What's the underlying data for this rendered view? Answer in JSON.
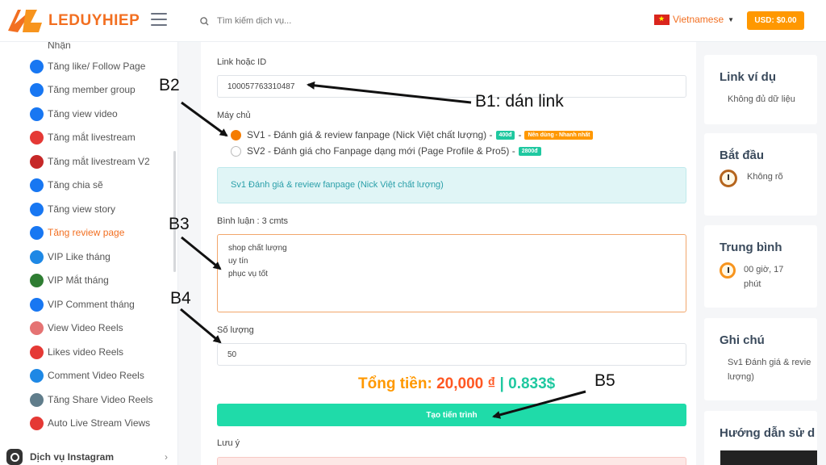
{
  "header": {
    "logo_text": "LEDUYHIEP",
    "search_placeholder": "Tìm kiếm dịch vụ...",
    "language": "Vietnamese",
    "balance_button": "USD: $0.00"
  },
  "sidebar": {
    "items": [
      {
        "label": "Nhận",
        "icon": "partial-icon",
        "color": "#9aa"
      },
      {
        "label": "Tăng like/ Follow Page",
        "icon": "flag-icon",
        "color": "#1877f2"
      },
      {
        "label": "Tăng member group",
        "icon": "group-icon",
        "color": "#1877f2"
      },
      {
        "label": "Tăng view video",
        "icon": "play-icon",
        "color": "#1877f2"
      },
      {
        "label": "Tăng mắt livestream",
        "icon": "live-icon",
        "color": "#e53935"
      },
      {
        "label": "Tăng mắt livestream V2",
        "icon": "eye-icon",
        "color": "#c62828"
      },
      {
        "label": "Tăng chia sẽ",
        "icon": "share-icon",
        "color": "#1877f2"
      },
      {
        "label": "Tăng view story",
        "icon": "heart-icon",
        "color": "#1877f2"
      },
      {
        "label": "Tăng review page",
        "icon": "palette-icon",
        "color": "#1877f2",
        "active": true
      },
      {
        "label": "VIP Like tháng",
        "icon": "clock-icon",
        "color": "#1e88e5"
      },
      {
        "label": "VIP Mắt tháng",
        "icon": "eye-icon",
        "color": "#2e7d32"
      },
      {
        "label": "VIP Comment tháng",
        "icon": "comment-icon",
        "color": "#1877f2"
      },
      {
        "label": "View Video Reels",
        "icon": "reels-icon",
        "color": "#e57373"
      },
      {
        "label": "Likes video Reels",
        "icon": "thumb-icon",
        "color": "#e53935"
      },
      {
        "label": "Comment Video Reels",
        "icon": "comment-reels-icon",
        "color": "#1e88e5"
      },
      {
        "label": "Tăng Share Video Reels",
        "icon": "share-reels-icon",
        "color": "#607d8b"
      },
      {
        "label": "Auto Live Stream Views",
        "icon": "live-views-icon",
        "color": "#e53935"
      }
    ],
    "section": "Dịch vụ Instagram"
  },
  "form": {
    "link_label": "Link hoặc ID",
    "link_value": "100057763310487",
    "server_label": "Máy chủ",
    "servers": [
      {
        "text": "SV1 - Đánh giá & review fanpage (Nick Việt chất lượng) -",
        "price": "400đ",
        "extra": "Nên dùng - Nhanh nhất",
        "checked": true
      },
      {
        "text": "SV2 - Đánh giá cho Fanpage dạng mới (Page Profile & Pro5) -",
        "price": "2800đ",
        "checked": false
      }
    ],
    "info": "Sv1 Đánh giá & review fanpage (Nick Việt chất lượng)",
    "comment_label": "Bình luận : 3 cmts",
    "comments": [
      "shop chất lượng",
      "uy tín",
      "phục vụ tốt"
    ],
    "quantity_label": "Số lượng",
    "quantity_value": "50",
    "total_label": "Tổng tiền:",
    "total_vnd": "20,000 ₫",
    "total_sep": "|",
    "total_usd": "0.833$",
    "submit": "Tạo tiến trình",
    "note_label": "Lưu ý"
  },
  "right": {
    "example_title": "Link ví dụ",
    "example_body": "Không đủ dữ liệu",
    "start_title": "Bắt đầu",
    "start_body": "Không rõ",
    "avg_title": "Trung bình",
    "avg_body_1": "00 giờ, 17",
    "avg_body_2": "phút",
    "note_title": "Ghi chú",
    "note_body_1": "Sv1 Đánh giá & revie",
    "note_body_2": "lượng)",
    "guide_title": "Hướng dẫn sử d"
  },
  "annotations": {
    "b1": "B1: dán link",
    "b2": "B2",
    "b3": "B3",
    "b4": "B4",
    "b5": "B5"
  },
  "colors": {
    "brand": "#f26f21",
    "accent_green": "#1fdba9",
    "orange": "#ff9800"
  }
}
